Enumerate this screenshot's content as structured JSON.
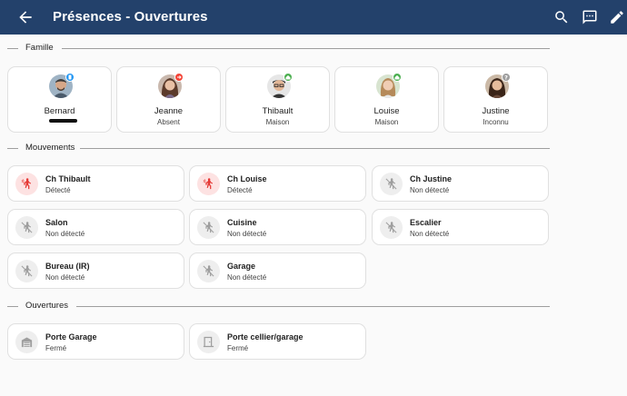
{
  "header": {
    "title": "Présences - Ouvertures",
    "back_icon": "arrow-left-icon",
    "icons": [
      "search-icon",
      "comment-icon",
      "pencil-icon"
    ]
  },
  "famille": {
    "label": "Famille",
    "people": [
      {
        "name": "Bernard",
        "state": "",
        "badge": "phone-icon",
        "badge_color": "#2196f3"
      },
      {
        "name": "Jeanne",
        "state": "Absent",
        "badge": "away-icon",
        "badge_color": "#f44336"
      },
      {
        "name": "Thibault",
        "state": "Maison",
        "badge": "home-icon",
        "badge_color": "#4caf50"
      },
      {
        "name": "Louise",
        "state": "Maison",
        "badge": "home-icon",
        "badge_color": "#4caf50"
      },
      {
        "name": "Justine",
        "state": "Inconnu",
        "badge": "question-icon",
        "badge_color": "#9e9e9e"
      }
    ]
  },
  "mouvements": {
    "label": "Mouvements",
    "sensors": [
      {
        "name": "Ch Thibault",
        "state": "Détecté",
        "active": true
      },
      {
        "name": "Ch Louise",
        "state": "Détecté",
        "active": true
      },
      {
        "name": "Ch Justine",
        "state": "Non détecté",
        "active": false
      },
      {
        "name": "Salon",
        "state": "Non détecté",
        "active": false
      },
      {
        "name": "Cuisine",
        "state": "Non détecté",
        "active": false
      },
      {
        "name": "Escalier",
        "state": "Non détecté",
        "active": false
      },
      {
        "name": "Bureau (IR)",
        "state": "Non détecté",
        "active": false
      },
      {
        "name": "Garage",
        "state": "Non détecté",
        "active": false
      }
    ]
  },
  "ouvertures": {
    "label": "Ouvertures",
    "doors": [
      {
        "name": "Porte Garage",
        "state": "Fermé",
        "icon": "garage-icon"
      },
      {
        "name": "Porte cellier/garage",
        "state": "Fermé",
        "icon": "door-icon"
      }
    ]
  },
  "colors": {
    "header": "#23416b",
    "active_bg": "#fde2e2",
    "active_icon": "#e53935",
    "inactive_icon": "#9e9e9e"
  }
}
